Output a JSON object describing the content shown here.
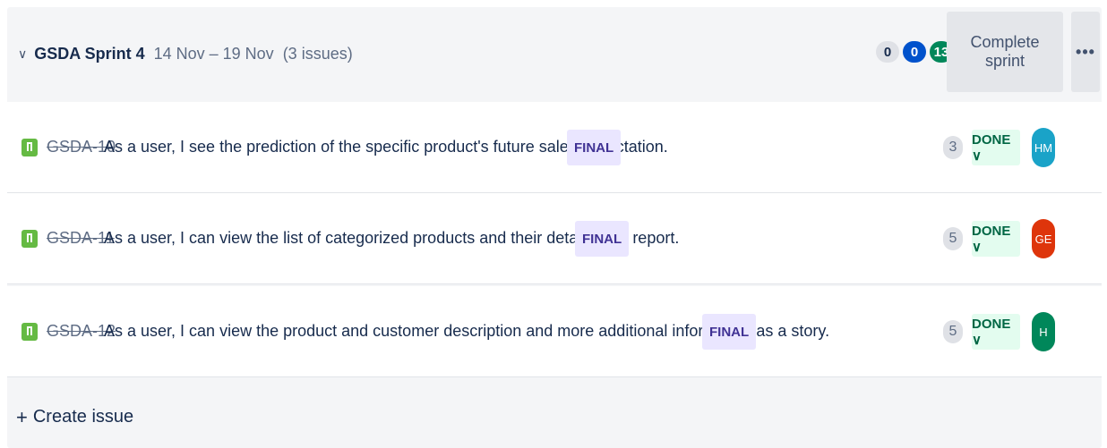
{
  "sprint": {
    "name": "GSDA Sprint 4",
    "dates": "14 Nov – 19 Nov",
    "issue_count": "(3 issues)",
    "counts": {
      "todo": "0",
      "in_progress": "0",
      "done": "13"
    },
    "complete_label": "Complete sprint",
    "more_label": "•••"
  },
  "issues": [
    {
      "key": "GSDA-10",
      "summary": "As a user, I see the prediction of the specific product's future sales expectation.",
      "epic": "FINAL",
      "points": "3",
      "status": "DONE ∨",
      "assignee_initials": "HM",
      "assignee_color": "#1aa3c8"
    },
    {
      "key": "GSDA-11",
      "summary": "As a user, I can view the list of categorized products and their details as a report.",
      "epic": "FINAL",
      "points": "5",
      "status": "DONE ∨",
      "assignee_initials": "GE",
      "assignee_color": "#de350b"
    },
    {
      "key": "GSDA-12",
      "summary": "As a user, I can view the product and customer description and more additional information as a story.",
      "epic": "FINAL",
      "points": "5",
      "status": "DONE ∨",
      "assignee_initials": "H",
      "assignee_color": "#00875a"
    }
  ],
  "create_issue": {
    "plus": "+",
    "label": "Create issue"
  },
  "colors": {
    "story_icon": "#65ba43",
    "epic_bg": "#eae6ff",
    "done_bg": "#e3fcef"
  }
}
